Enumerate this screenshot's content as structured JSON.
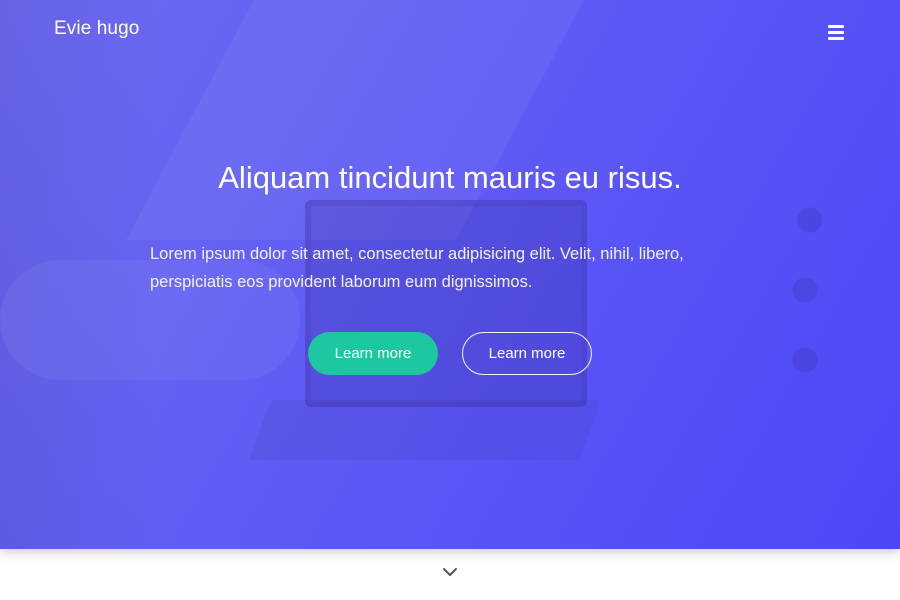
{
  "navbar": {
    "brand": "Evie hugo",
    "menu_icon": "hamburger-menu-icon"
  },
  "hero": {
    "headline": "Aliquam tincidunt mauris eu risus.",
    "lead": "Lorem ipsum dolor sit amet, consectetur adipisicing elit. Velit, nihil, libero, perspiciatis eos provident laborum eum dignissimos.",
    "buttons": [
      {
        "label": "Learn more",
        "style": "filled",
        "color": "#1dc8a0"
      },
      {
        "label": "Learn more",
        "style": "outline",
        "color": "#ffffff"
      }
    ],
    "gradient_colors": [
      "#6f6cf2",
      "#4d46f8"
    ]
  },
  "scroll_indicator": {
    "icon": "chevron-down-icon",
    "color": "#555555"
  }
}
